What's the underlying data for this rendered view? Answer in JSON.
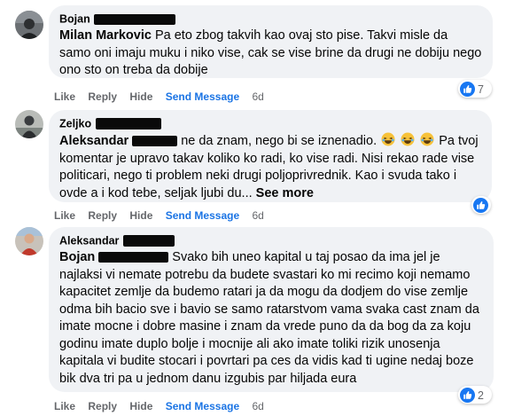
{
  "comments": [
    {
      "author": "Bojan",
      "tag": "Milan Markovic",
      "text": " Pa eto zbog takvih kao ovaj sto pise. Takvi misle da samo oni imaju muku i niko vise, cak se vise brine da drugi ne dobiju nego ono sto on treba da dobije",
      "like_count": "7",
      "time": "6d"
    },
    {
      "author": "Zeljko",
      "tag": "Aleksandar",
      "text_a": " ne da znam, nego bi se iznenadio.",
      "text_b": " Pa tvoj komentar je upravo takav koliko ko radi, ko vise radi. Nisi rekao rade vise politicari, nego ti problem neki drugi poljoprivrednik. Kao i svuda tako i ovde a i kod tebe, seljak ljubi du...",
      "see_more": "See more",
      "emoji": [
        "laughing-emoji",
        "laughing-emoji",
        "laughing-emoji"
      ],
      "like_count": "",
      "time": "6d"
    },
    {
      "author": "Aleksandar",
      "tag": "Bojan",
      "text": " Svako bih uneo kapital u taj posao da ima jel je najlaksi vi nemate potrebu da budete svastari ko mi recimo koji nemamo kapacitet zemlje da budemo ratari ja da mogu da dodjem do vise zemlje odma bih bacio sve i bavio se samo ratarstvom vama svaka cast znam da imate mocne i dobre masine i znam da vrede puno da da bog da za koju godinu imate duplo bolje i mocnije ali ako imate toliki rizik unosenja kapitala vi budite stocari i povrtari pa ces da vidis kad ti ugine nedaj boze bik dva tri pa u jednom danu izgubis par hiljada eura",
      "like_count": "2",
      "time": "6d"
    }
  ],
  "actions": {
    "like": "Like",
    "reply": "Reply",
    "hide": "Hide",
    "send": "Send Message"
  },
  "colors": {
    "bubble": "#f0f2f5",
    "send_message": "#1b74e4",
    "like_badge": "#1877f2",
    "secondary_text": "#65676b"
  }
}
